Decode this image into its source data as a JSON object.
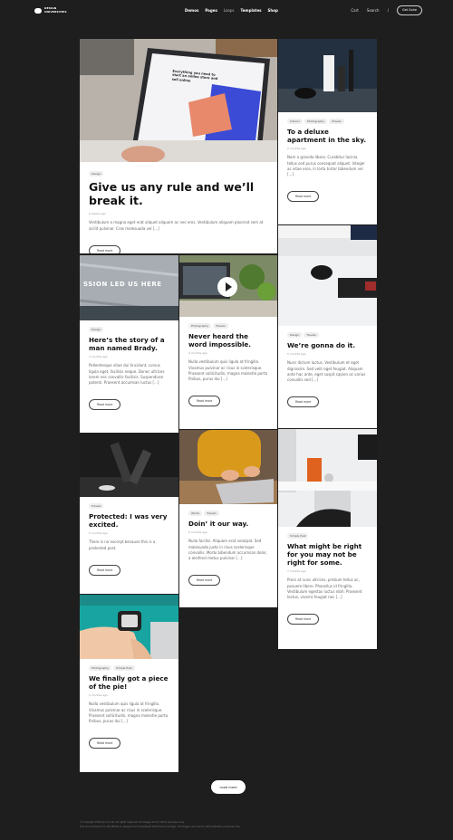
{
  "header": {
    "logo_line1": "DESIGN",
    "logo_line2": "UNIVERSITIES",
    "nav": [
      "Demos",
      "Pages",
      "Loops",
      "Templates",
      "Shop"
    ],
    "cart": "Cart",
    "search": "Search",
    "divider": "/",
    "cta": "Get Gohe"
  },
  "posts": [
    {
      "tags": [
        "Design"
      ],
      "title": "Give us any rule and we’ll break it.",
      "date": "8 weeks ago",
      "excerpt": "Vestibulum a magna eget erat aliquet aliquam ac nec eros. Vestibulum aliquam placerat sem at sicilit pulvinar. Cras malesuada vel [...]",
      "read_more": "Read more",
      "screen_headline": "Everything you need to start an online store and sell online"
    },
    {
      "tags": [
        "Interior",
        "Photography",
        "Travels"
      ],
      "title": "To a deluxe apartment in the sky.",
      "date": "2 months ago",
      "excerpt": "Nam a gravida libero. Curabitur lacinia tellus sed purus consequat aliquet. Integer ac vitae eros, in lorta tortor bibendum vel [...]",
      "read_more": "Read more"
    },
    {
      "tags": [
        "Design"
      ],
      "title": "Here’s the story of a man named Brady.",
      "date": "4 months ago",
      "excerpt": "Pellentesque vitae dui tincidunt, cursus ligula eget, facilisis neque. Donec ultrices lorem nec convallis facilisis. Suspendisse potenti. Praesent accumsan luctus [...]",
      "read_more": "Read more",
      "sign_text": "SSION LED US HERE"
    },
    {
      "tags": [
        "Photography",
        "Travels"
      ],
      "title": "Never heard the word impossible.",
      "date": "4 months ago",
      "excerpt": "Nulla vestibulum quis ligula at fringilla. Vivamus pulvinar ac risus in scelerisque. Praesent sollicitudin, magna molestie porta finibus, purus dui [...]",
      "read_more": "Read more"
    },
    {
      "tags": [
        "Design",
        "Travels"
      ],
      "title": "We’re gonna do it.",
      "date": "5 months ago",
      "excerpt": "Nunc dictum luctus. Vestibulum et eget dignissim. Sed velit eget feugiat. Aliquam ante hac ante, eget suspit sapien ac varius convallis sed [...]",
      "read_more": "Read more"
    },
    {
      "tags": [
        "Travels"
      ],
      "title": "Protected: I was very excited.",
      "date": "5 months ago",
      "excerpt": "There is no excerpt because this is a protected post.",
      "read_more": "Read more"
    },
    {
      "tags": [
        "Works",
        "Travels"
      ],
      "title": "Doin’ it our way.",
      "date": "6 months ago",
      "excerpt": "Nulla facilisi. Aliquam erat volutpat. Sed malesuada justo in risus scelerisque convallis. Morbi bibendum accumsan dolor, a eleifend metus pulvinar [...]",
      "read_more": "Read more"
    },
    {
      "tags": [
        "Simple Post"
      ],
      "title": "What might be right for you may not be right for some.",
      "date": "7 months ago",
      "excerpt": "Proin at nunc ultrices, pretium tellus ac, posuere libero. Phasellus id fringilla. Vestibulum egestas luctus nibh. Praesent lectus, viverra feugiat nec [...]",
      "read_more": "Read more"
    },
    {
      "tags": [
        "Photography",
        "Simple Post"
      ],
      "title": "We finally got a piece of the pie!",
      "date": "9 months ago",
      "excerpt": "Nulla vestibulum quis ligula at fringilla. Vivamus pulvinar ac risus in scelerisque. Praesent sollicitudin, magna molestie porta finibus, purus dui [...]",
      "read_more": "Read more"
    }
  ],
  "load_more": "Load more",
  "footer": {
    "line1": "© Copyright 2024 by Uncode. All rights reserved. All images are for demo purposes only.",
    "line2": "The Uncode theme for WordPress is designed and developed with love by Undsgn. All images used are for demonstration purposes only."
  },
  "colors": {
    "background": "#1e1e1e",
    "card": "#ffffff",
    "tag": "#eeeeee"
  }
}
